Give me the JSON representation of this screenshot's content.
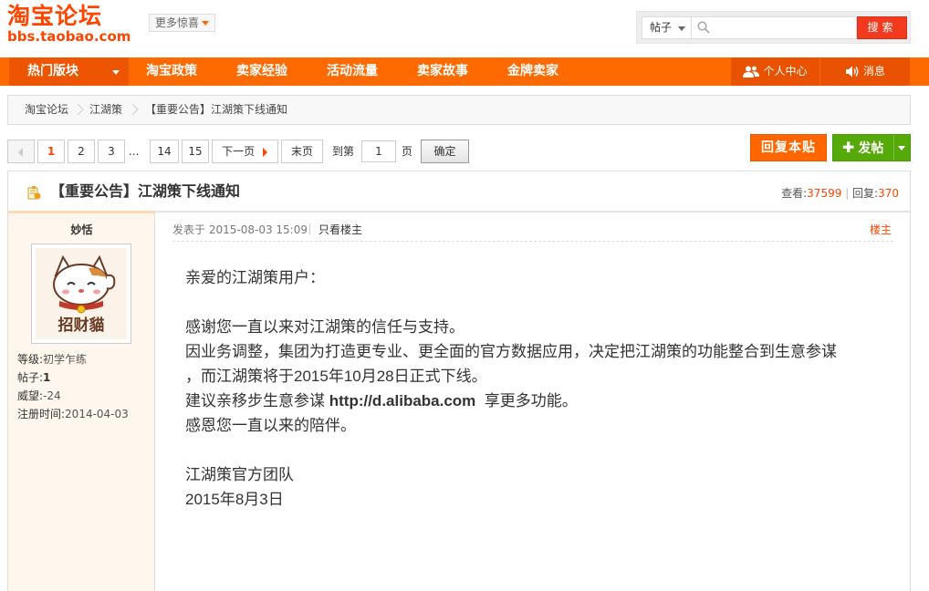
{
  "header": {
    "logo_cn": "淘宝论坛",
    "logo_en": "bbs.taobao.com",
    "more_label": "更多惊喜",
    "search": {
      "type_label": "帖子",
      "placeholder": "",
      "button_label": "搜索"
    }
  },
  "nav": {
    "hot_label": "热门版块",
    "items": [
      "淘宝政策",
      "卖家经验",
      "活动流量",
      "卖家故事",
      "金牌卖家"
    ],
    "personal_label": "个人中心",
    "message_label": "消息"
  },
  "breadcrumb": [
    "淘宝论坛",
    "江湖策",
    "【重要公告】江湖策下线通知"
  ],
  "pager": {
    "pages": [
      "1",
      "2",
      "3",
      "14",
      "15"
    ],
    "ellipsis": "...",
    "next_label": "下一页",
    "last_label": "末页",
    "goto_label": "到第",
    "page_value": "1",
    "page_unit": "页",
    "confirm_label": "确定"
  },
  "actions": {
    "reply_label": "回复本贴",
    "post_label": "发帖"
  },
  "thread": {
    "title": "【重要公告】江湖策下线通知",
    "views_label": "查看:",
    "views": "37599",
    "replies_label": "回复:",
    "replies": "370"
  },
  "author": {
    "name": "妙恬",
    "level_label": "等级:",
    "level": "初学乍练",
    "posts_label": "帖子:",
    "posts": "1",
    "prestige_label": "威望:",
    "prestige": "-24",
    "reg_label": "注册时间:",
    "reg_date": "2014-04-03",
    "avatar_text": "招财貓"
  },
  "post": {
    "posted_label": "发表于",
    "posted_at": "2015-08-03 15:09",
    "only_op_label": "只看楼主",
    "floor_label": "楼主",
    "lines": [
      "亲爱的江湖策用户：",
      "",
      "感谢您一直以来对江湖策的信任与支持。",
      "因业务调整，集团为打造更专业、更全面的官方数据应用，决定把江湖策的功能整合到生意参谋",
      "，而江湖策将于2015年10月28日正式下线。"
    ],
    "line_suggest_pre": "建议亲移步生意参谋 ",
    "line_suggest_url": "http://d.alibaba.com",
    "line_suggest_post": "  享更多功能。",
    "line_thanks": "感恩您一直以来的陪伴。",
    "signature": "江湖策官方团队",
    "date": "2015年8月3日"
  },
  "colors": {
    "brand_orange": "#ff6a00",
    "accent_red": "#ff4400",
    "post_green": "#55aa0a"
  }
}
